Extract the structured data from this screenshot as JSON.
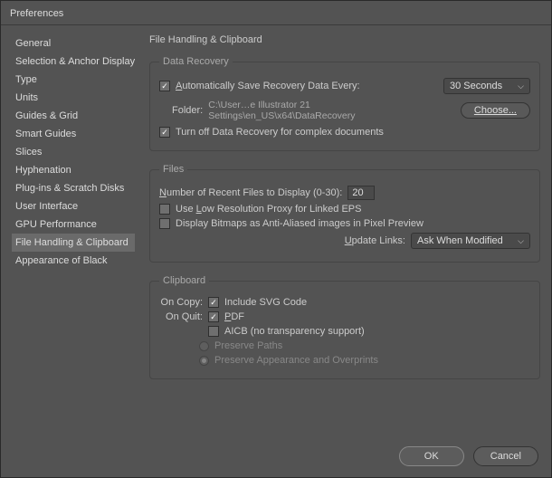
{
  "window": {
    "title": "Preferences"
  },
  "sidebar": {
    "items": [
      {
        "label": "General"
      },
      {
        "label": "Selection & Anchor Display"
      },
      {
        "label": "Type"
      },
      {
        "label": "Units"
      },
      {
        "label": "Guides & Grid"
      },
      {
        "label": "Smart Guides"
      },
      {
        "label": "Slices"
      },
      {
        "label": "Hyphenation"
      },
      {
        "label": "Plug-ins & Scratch Disks"
      },
      {
        "label": "User Interface"
      },
      {
        "label": "GPU Performance"
      },
      {
        "label": "File Handling & Clipboard"
      },
      {
        "label": "Appearance of Black"
      }
    ],
    "selected_index": 11
  },
  "panel": {
    "title": "File Handling & Clipboard",
    "data_recovery": {
      "legend": "Data Recovery",
      "auto_save_label_pre": "A",
      "auto_save_label_rest": "utomatically Save Recovery Data Every:",
      "interval": "30 Seconds",
      "folder_label": "Folder:",
      "folder_path": "C:\\User…e Illustrator 21 Settings\\en_US\\x64\\DataRecovery",
      "choose_btn": "Choose...",
      "turn_off_label": "Turn off Data Recovery for complex documents"
    },
    "files": {
      "legend": "Files",
      "recent_pre": "N",
      "recent_rest": "umber of Recent Files to Display (0-30):",
      "recent_value": "20",
      "low_res_pre": "Use ",
      "low_res_ul": "L",
      "low_res_rest": "ow Resolution Proxy for Linked EPS",
      "bitmaps_label": "Display Bitmaps as Anti-Aliased images in Pixel Preview",
      "update_links_pre": "U",
      "update_links_rest": "pdate Links:",
      "update_links_value": "Ask When Modified"
    },
    "clipboard": {
      "legend": "Clipboard",
      "on_copy": "On Copy:",
      "include_svg": "Include SVG Code",
      "on_quit": "On Quit:",
      "pdf_ul": "P",
      "pdf_rest": "DF",
      "aicb_label": "AICB (no transparency support)",
      "preserve_paths": "Preserve Paths",
      "preserve_appearance": "Preserve Appearance and Overprints"
    }
  },
  "footer": {
    "ok": "OK",
    "cancel": "Cancel"
  }
}
